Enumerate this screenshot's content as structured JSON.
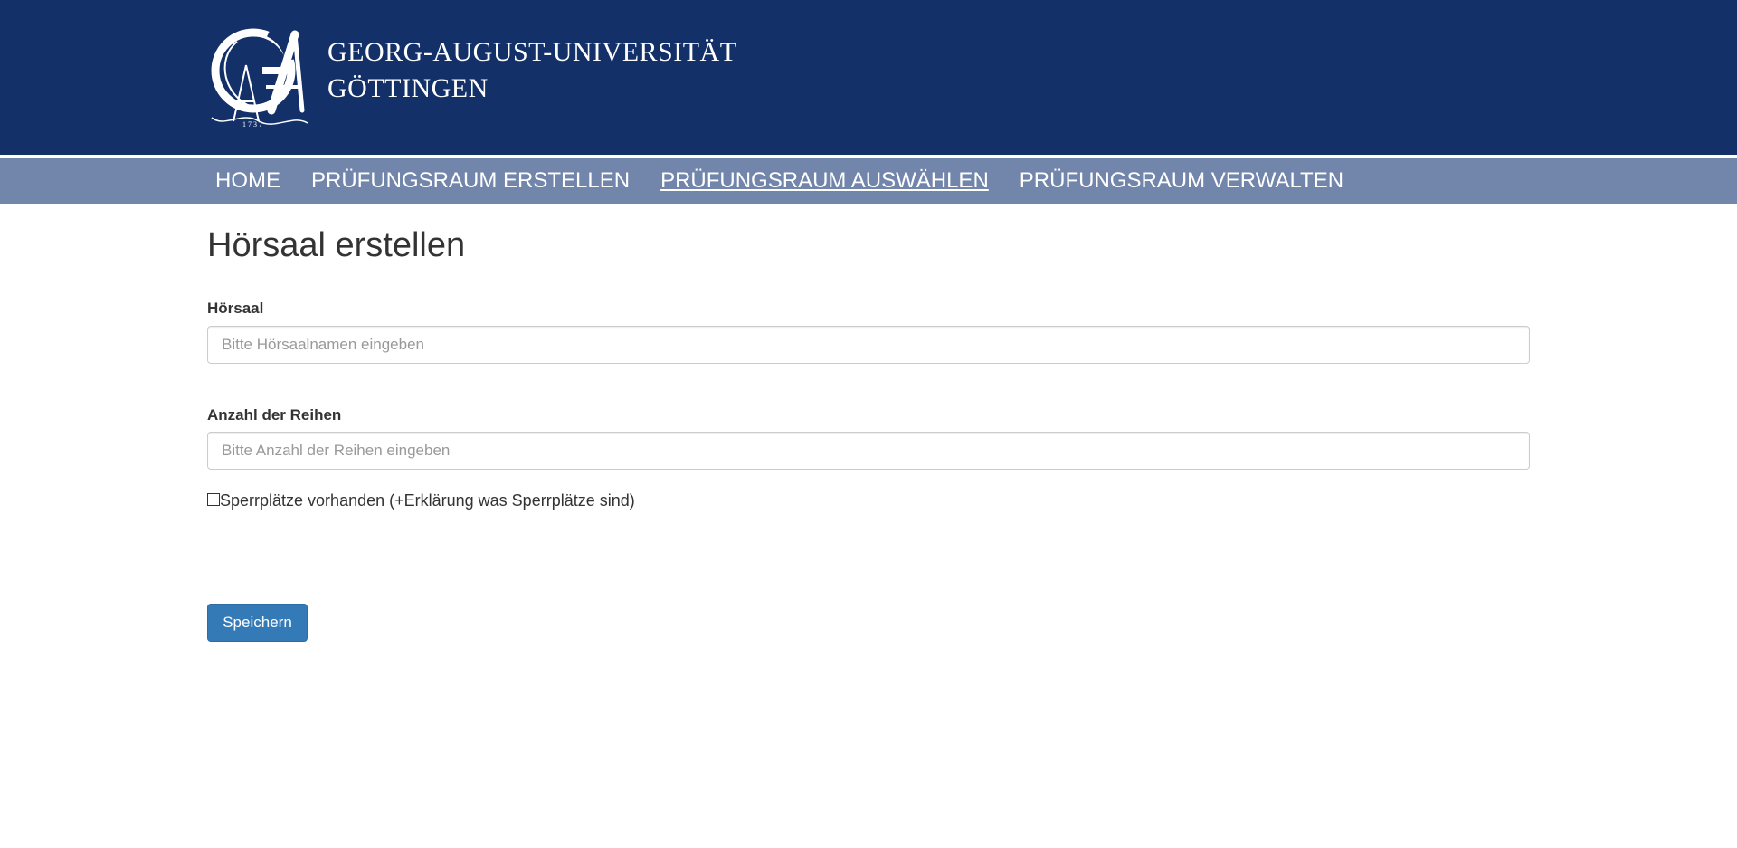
{
  "header": {
    "university_line1": "GEORG-AUGUST-UNIVERSITÄT",
    "university_line2": "GÖTTINGEN",
    "background_color": "#143069",
    "logo_icon": "university-seal-icon"
  },
  "nav": {
    "background_color": "#7285ab",
    "items": [
      {
        "label": "HOME",
        "active": false
      },
      {
        "label": "PRÜFUNGSRAUM ERSTELLEN",
        "active": false
      },
      {
        "label": "PRÜFUNGSRAUM AUSWÄHLEN",
        "active": true
      },
      {
        "label": "PRÜFUNGSRAUM VERWALTEN",
        "active": false
      }
    ]
  },
  "page": {
    "title": "Hörsaal erstellen"
  },
  "form": {
    "hoersaal": {
      "label": "Hörsaal",
      "value": "",
      "placeholder": "Bitte Hörsaalnamen eingeben"
    },
    "reihen": {
      "label": "Anzahl der Reihen",
      "value": "",
      "placeholder": "Bitte Anzahl der Reihen eingeben"
    },
    "sperrplaetze": {
      "label": "Sperrplätze vorhanden (+Erklärung was Sperrplätze sind)",
      "checked": false
    },
    "save_label": "Speichern",
    "accent_color": "#337ab7"
  }
}
